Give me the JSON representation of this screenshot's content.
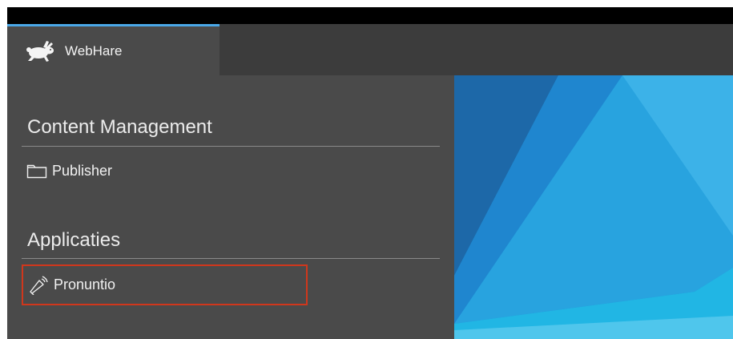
{
  "tabs": [
    {
      "label": "WebHare",
      "icon": "rabbit-logo-icon",
      "active": true
    }
  ],
  "sections": [
    {
      "title": "Content Management",
      "items": [
        {
          "label": "Publisher",
          "icon": "folder-icon"
        }
      ]
    },
    {
      "title": "Applicaties",
      "items": [
        {
          "label": "Pronuntio",
          "icon": "megaphone-icon",
          "selected": true
        }
      ]
    }
  ],
  "colors": {
    "accent": "#4aa8e8",
    "highlight_border": "#d0371c",
    "sidebar_bg": "#4a4a4a",
    "tabbar_bg": "#3c3c3c"
  }
}
